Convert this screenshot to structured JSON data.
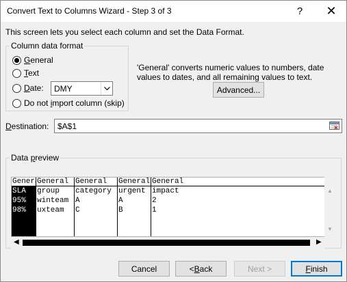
{
  "window": {
    "title": "Convert Text to Columns Wizard - Step 3 of 3",
    "help_label": "?",
    "close_label": "✕"
  },
  "intro": "This screen lets you select each column and set the Data Format.",
  "format": {
    "group_label": "Column data format",
    "options": [
      {
        "label_u": "G",
        "label_rest": "eneral",
        "checked": true
      },
      {
        "label_u": "T",
        "label_rest": "ext",
        "checked": false
      },
      {
        "label_u": "D",
        "label_rest": "ate:",
        "checked": false
      },
      {
        "label_pre": "Do not ",
        "label_u": "i",
        "label_rest": "mport column (skip)",
        "checked": false
      }
    ],
    "date_value": "DMY",
    "description": "'General' converts numeric values to numbers, date values to dates, and all remaining values to text.",
    "advanced_label": "Advanced..."
  },
  "destination": {
    "label_u": "D",
    "label_rest": "estination:",
    "value": "$A$1"
  },
  "preview": {
    "group_label_pre": "Data ",
    "group_label_u": "p",
    "group_label_rest": "review",
    "columns": [
      {
        "header": "General",
        "cells": [
          "SLA",
          "95%",
          "98%"
        ]
      },
      {
        "header": "General",
        "cells": [
          "group",
          "winteam",
          "uxteam"
        ]
      },
      {
        "header": "General",
        "cells": [
          "category",
          "A",
          "C"
        ]
      },
      {
        "header": "General",
        "cells": [
          "urgent",
          "A",
          "B"
        ]
      },
      {
        "header": "General",
        "cells": [
          "impact",
          "2",
          "1"
        ]
      }
    ]
  },
  "buttons": {
    "cancel": "Cancel",
    "back_pre": "< ",
    "back_u": "B",
    "back_rest": "ack",
    "next": "Next >",
    "finish_u": "F",
    "finish_rest": "inish"
  },
  "colors": {
    "accent": "#0078d7",
    "dialog_bg": "#f0f0f0",
    "selected_column_bg": "#000000"
  }
}
